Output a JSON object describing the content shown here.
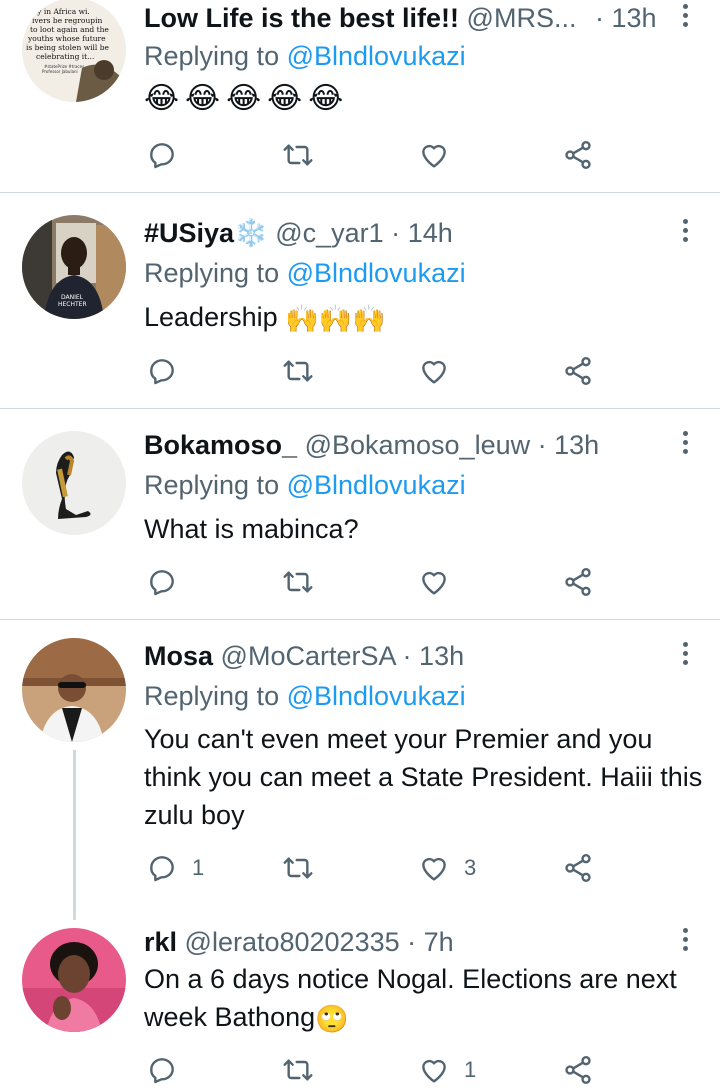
{
  "tweets": [
    {
      "name": "Low Life is the best life!!",
      "handle": "@MRS...",
      "time": "13h",
      "replying_prefix": "Replying to ",
      "replying_to": "@Blndlovukazi",
      "text": "",
      "emoji_text": "😂😂😂😂😂",
      "reply_count": "",
      "retweet_count": "",
      "like_count": "",
      "avatar_text": "...nly in Africa wi... drivers be regrouping to loot again and the youths whose future is being stolen will be celebrating it..."
    },
    {
      "name": "#USiya",
      "name_emoji": "❄️",
      "handle": "@c_yar1",
      "time": "14h",
      "replying_prefix": "Replying to ",
      "replying_to": "@Blndlovukazi",
      "text": "Leadership ",
      "emoji_text": "🙌🙌🙌",
      "reply_count": "",
      "retweet_count": "",
      "like_count": "",
      "avatar_shirt_text": "DANIEL HECHTER"
    },
    {
      "name": "Bokamoso_",
      "handle": "@Bokamoso_leuw",
      "time": "13h",
      "replying_prefix": "Replying to ",
      "replying_to": "@Blndlovukazi",
      "text": "What is mabinca?",
      "reply_count": "",
      "retweet_count": "",
      "like_count": ""
    },
    {
      "name": "Mosa",
      "handle": "@MoCarterSA",
      "time": "13h",
      "replying_prefix": "Replying to ",
      "replying_to": "@Blndlovukazi",
      "text": "You can't even meet your Premier and you think you can meet a State President. Haiii this zulu boy",
      "reply_count": "1",
      "retweet_count": "",
      "like_count": "3"
    },
    {
      "name": "rkl",
      "handle": "@lerato80202335",
      "time": "7h",
      "text": "On a 6 days notice Nogal. Elections are next week Bathong",
      "emoji_text": "🙄",
      "reply_count": "",
      "retweet_count": "",
      "like_count": "1"
    }
  ],
  "separator": "·",
  "colors": {
    "text": "#0f1419",
    "secondary": "#536471",
    "link": "#1d9bf0",
    "divider": "#cfd9de"
  },
  "icons": [
    "reply-icon",
    "retweet-icon",
    "like-icon",
    "share-icon",
    "more-icon"
  ]
}
